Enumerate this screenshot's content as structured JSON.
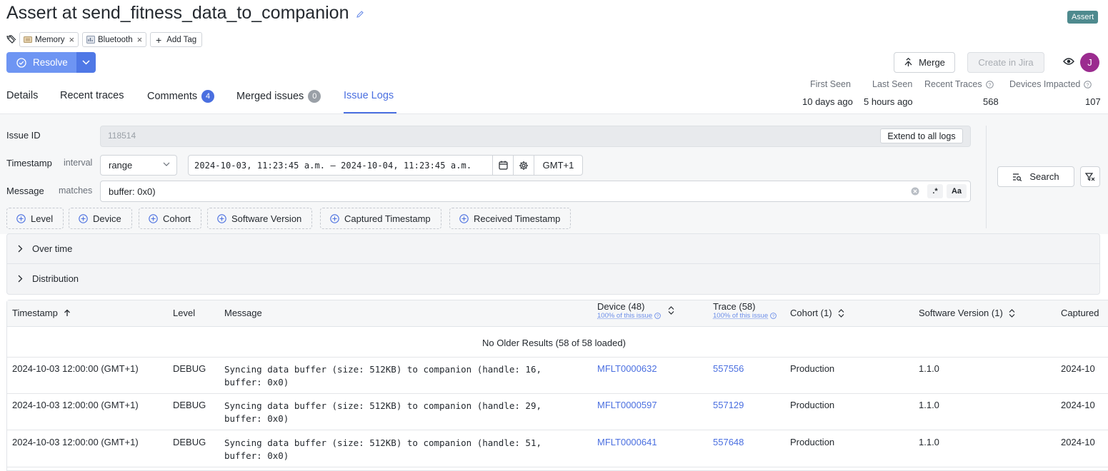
{
  "issue": {
    "title": "Assert at send_fitness_data_to_companion",
    "type_badge": "Assert",
    "tags": [
      {
        "label": "Memory"
      },
      {
        "label": "Bluetooth"
      }
    ],
    "add_tag_label": "Add Tag"
  },
  "actions": {
    "resolve_label": "Resolve",
    "merge_label": "Merge",
    "jira_label": "Create in Jira",
    "avatar_initial": "J"
  },
  "tabs": [
    {
      "label": "Details",
      "active": false
    },
    {
      "label": "Recent traces",
      "active": false
    },
    {
      "label": "Comments",
      "count": "4",
      "count_color": "#4a6fe0",
      "active": false
    },
    {
      "label": "Merged issues",
      "count": "0",
      "count_color": "#9aa0a7",
      "active": false
    },
    {
      "label": "Issue Logs",
      "active": true
    }
  ],
  "stats": {
    "first_seen": {
      "label": "First Seen",
      "value": "10 days ago"
    },
    "last_seen": {
      "label": "Last Seen",
      "value": "5 hours ago"
    },
    "recent_traces": {
      "label": "Recent Traces",
      "value": "568"
    },
    "devices_impacted": {
      "label": "Devices Impacted",
      "value": "107"
    }
  },
  "filters": {
    "issue_id": {
      "label": "Issue ID",
      "value": "118514",
      "extend_label": "Extend to all logs"
    },
    "timestamp": {
      "label": "Timestamp",
      "operator": "interval",
      "mode": "range",
      "range": "2024-10-03, 11:23:45 a.m. – 2024-10-04, 11:23:45 a.m.",
      "timezone": "GMT+1"
    },
    "message": {
      "label": "Message",
      "operator": "matches",
      "value": "buffer: 0x0)",
      "regex_label": ".*",
      "case_label": "Aa"
    },
    "chips": [
      "Level",
      "Device",
      "Cohort",
      "Software Version",
      "Captured Timestamp",
      "Received Timestamp"
    ],
    "search_label": "Search"
  },
  "sections": {
    "over_time": "Over time",
    "distribution": "Distribution"
  },
  "table": {
    "headers": {
      "timestamp": "Timestamp",
      "level": "Level",
      "message": "Message",
      "device": "Device (48)",
      "device_sub": "100% of this issue",
      "trace": "Trace (58)",
      "trace_sub": "100% of this issue",
      "cohort": "Cohort (1)",
      "software_version": "Software Version (1)",
      "captured": "Captured"
    },
    "no_older": "No Older Results (58 of 58 loaded)",
    "rows": [
      {
        "timestamp": "2024-10-03 12:00:00 (GMT+1)",
        "level": "DEBUG",
        "message": "Syncing data buffer (size: 512KB) to companion (handle: 16, buffer: 0x0)",
        "device": "MFLT0000632",
        "trace": "557556",
        "cohort": "Production",
        "version": "1.1.0",
        "captured": "2024-10"
      },
      {
        "timestamp": "2024-10-03 12:00:00 (GMT+1)",
        "level": "DEBUG",
        "message": "Syncing data buffer (size: 512KB) to companion (handle: 29, buffer: 0x0)",
        "device": "MFLT0000597",
        "trace": "557129",
        "cohort": "Production",
        "version": "1.1.0",
        "captured": "2024-10"
      },
      {
        "timestamp": "2024-10-03 12:00:00 (GMT+1)",
        "level": "DEBUG",
        "message": "Syncing data buffer (size: 512KB) to companion (handle: 51, buffer: 0x0)",
        "device": "MFLT0000641",
        "trace": "557648",
        "cohort": "Production",
        "version": "1.1.0",
        "captured": "2024-10"
      }
    ]
  },
  "icons": {
    "edit": "pencil-icon",
    "tags": "tags-icon",
    "resolve": "check-circle-icon",
    "merge": "merge-icon",
    "watch": "eye-icon",
    "calendar": "calendar-icon",
    "settings": "gear-icon",
    "clear": "clear-circle-icon",
    "add": "plus-circle-icon",
    "search": "search-list-icon",
    "filter": "filter-clear-icon",
    "sort": "sort-icon",
    "expand": "chevron-right-icon"
  }
}
